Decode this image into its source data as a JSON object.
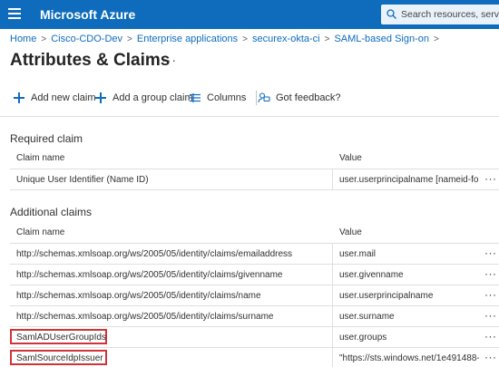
{
  "header": {
    "brand": "Microsoft Azure",
    "search_placeholder": "Search resources, services,"
  },
  "breadcrumb": [
    "Home",
    "Cisco-CDO-Dev",
    "Enterprise applications",
    "securex-okta-ci",
    "SAML-based Sign-on"
  ],
  "page": {
    "title": "Attributes & Claims",
    "more": "···"
  },
  "toolbar": {
    "add_claim": "Add new claim",
    "add_group_claim": "Add a group claim",
    "columns": "Columns",
    "feedback": "Got feedback?"
  },
  "required": {
    "title": "Required claim",
    "col_name": "Claim name",
    "col_value": "Value",
    "rows": [
      {
        "name": "Unique User Identifier (Name ID)",
        "value": "user.userprincipalname [nameid-for..."
      }
    ]
  },
  "additional": {
    "title": "Additional claims",
    "col_name": "Claim name",
    "col_value": "Value",
    "rows": [
      {
        "name": "http://schemas.xmlsoap.org/ws/2005/05/identity/claims/emailaddress",
        "value": "user.mail"
      },
      {
        "name": "http://schemas.xmlsoap.org/ws/2005/05/identity/claims/givenname",
        "value": "user.givenname"
      },
      {
        "name": "http://schemas.xmlsoap.org/ws/2005/05/identity/claims/name",
        "value": "user.userprincipalname"
      },
      {
        "name": "http://schemas.xmlsoap.org/ws/2005/05/identity/claims/surname",
        "value": "user.surname"
      },
      {
        "name": "SamlADUserGroupIds",
        "value": "user.groups"
      },
      {
        "name": "SamlSourceIdpIssuer",
        "value": "\"https://sts.windows.net/1e491488-..."
      }
    ]
  },
  "row_action": "···",
  "colors": {
    "topbar": "#0f6cbd",
    "link": "#0f6cbd",
    "highlight": "#d13438"
  }
}
